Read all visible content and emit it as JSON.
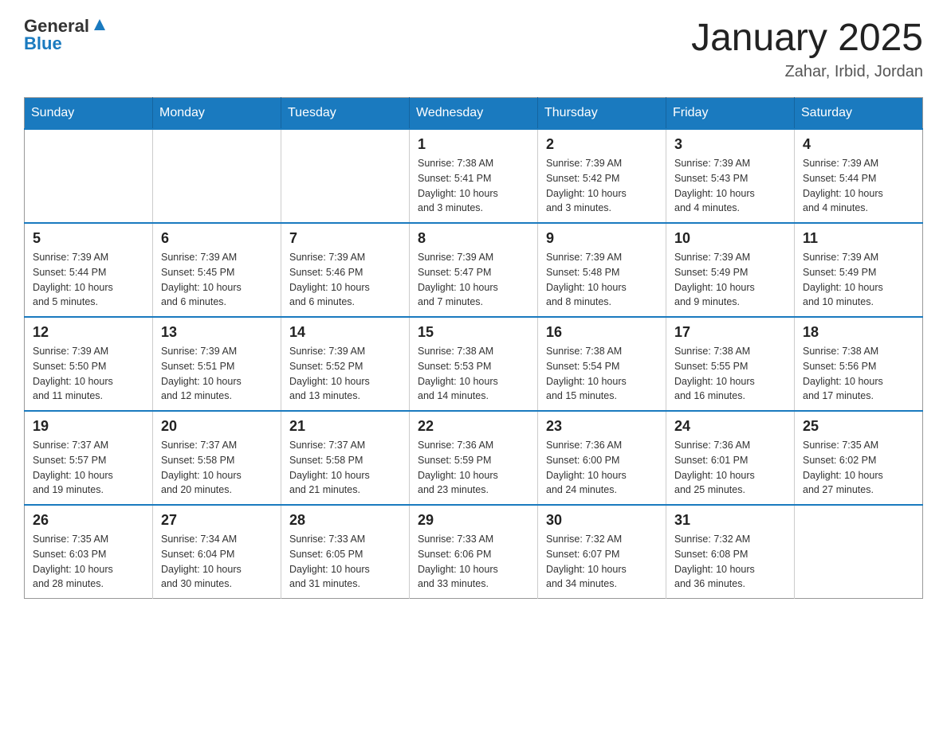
{
  "header": {
    "logo_text": "General",
    "logo_blue": "Blue",
    "title": "January 2025",
    "subtitle": "Zahar, Irbid, Jordan"
  },
  "days_of_week": [
    "Sunday",
    "Monday",
    "Tuesday",
    "Wednesday",
    "Thursday",
    "Friday",
    "Saturday"
  ],
  "weeks": [
    [
      {
        "day": "",
        "info": ""
      },
      {
        "day": "",
        "info": ""
      },
      {
        "day": "",
        "info": ""
      },
      {
        "day": "1",
        "info": "Sunrise: 7:38 AM\nSunset: 5:41 PM\nDaylight: 10 hours\nand 3 minutes."
      },
      {
        "day": "2",
        "info": "Sunrise: 7:39 AM\nSunset: 5:42 PM\nDaylight: 10 hours\nand 3 minutes."
      },
      {
        "day": "3",
        "info": "Sunrise: 7:39 AM\nSunset: 5:43 PM\nDaylight: 10 hours\nand 4 minutes."
      },
      {
        "day": "4",
        "info": "Sunrise: 7:39 AM\nSunset: 5:44 PM\nDaylight: 10 hours\nand 4 minutes."
      }
    ],
    [
      {
        "day": "5",
        "info": "Sunrise: 7:39 AM\nSunset: 5:44 PM\nDaylight: 10 hours\nand 5 minutes."
      },
      {
        "day": "6",
        "info": "Sunrise: 7:39 AM\nSunset: 5:45 PM\nDaylight: 10 hours\nand 6 minutes."
      },
      {
        "day": "7",
        "info": "Sunrise: 7:39 AM\nSunset: 5:46 PM\nDaylight: 10 hours\nand 6 minutes."
      },
      {
        "day": "8",
        "info": "Sunrise: 7:39 AM\nSunset: 5:47 PM\nDaylight: 10 hours\nand 7 minutes."
      },
      {
        "day": "9",
        "info": "Sunrise: 7:39 AM\nSunset: 5:48 PM\nDaylight: 10 hours\nand 8 minutes."
      },
      {
        "day": "10",
        "info": "Sunrise: 7:39 AM\nSunset: 5:49 PM\nDaylight: 10 hours\nand 9 minutes."
      },
      {
        "day": "11",
        "info": "Sunrise: 7:39 AM\nSunset: 5:49 PM\nDaylight: 10 hours\nand 10 minutes."
      }
    ],
    [
      {
        "day": "12",
        "info": "Sunrise: 7:39 AM\nSunset: 5:50 PM\nDaylight: 10 hours\nand 11 minutes."
      },
      {
        "day": "13",
        "info": "Sunrise: 7:39 AM\nSunset: 5:51 PM\nDaylight: 10 hours\nand 12 minutes."
      },
      {
        "day": "14",
        "info": "Sunrise: 7:39 AM\nSunset: 5:52 PM\nDaylight: 10 hours\nand 13 minutes."
      },
      {
        "day": "15",
        "info": "Sunrise: 7:38 AM\nSunset: 5:53 PM\nDaylight: 10 hours\nand 14 minutes."
      },
      {
        "day": "16",
        "info": "Sunrise: 7:38 AM\nSunset: 5:54 PM\nDaylight: 10 hours\nand 15 minutes."
      },
      {
        "day": "17",
        "info": "Sunrise: 7:38 AM\nSunset: 5:55 PM\nDaylight: 10 hours\nand 16 minutes."
      },
      {
        "day": "18",
        "info": "Sunrise: 7:38 AM\nSunset: 5:56 PM\nDaylight: 10 hours\nand 17 minutes."
      }
    ],
    [
      {
        "day": "19",
        "info": "Sunrise: 7:37 AM\nSunset: 5:57 PM\nDaylight: 10 hours\nand 19 minutes."
      },
      {
        "day": "20",
        "info": "Sunrise: 7:37 AM\nSunset: 5:58 PM\nDaylight: 10 hours\nand 20 minutes."
      },
      {
        "day": "21",
        "info": "Sunrise: 7:37 AM\nSunset: 5:58 PM\nDaylight: 10 hours\nand 21 minutes."
      },
      {
        "day": "22",
        "info": "Sunrise: 7:36 AM\nSunset: 5:59 PM\nDaylight: 10 hours\nand 23 minutes."
      },
      {
        "day": "23",
        "info": "Sunrise: 7:36 AM\nSunset: 6:00 PM\nDaylight: 10 hours\nand 24 minutes."
      },
      {
        "day": "24",
        "info": "Sunrise: 7:36 AM\nSunset: 6:01 PM\nDaylight: 10 hours\nand 25 minutes."
      },
      {
        "day": "25",
        "info": "Sunrise: 7:35 AM\nSunset: 6:02 PM\nDaylight: 10 hours\nand 27 minutes."
      }
    ],
    [
      {
        "day": "26",
        "info": "Sunrise: 7:35 AM\nSunset: 6:03 PM\nDaylight: 10 hours\nand 28 minutes."
      },
      {
        "day": "27",
        "info": "Sunrise: 7:34 AM\nSunset: 6:04 PM\nDaylight: 10 hours\nand 30 minutes."
      },
      {
        "day": "28",
        "info": "Sunrise: 7:33 AM\nSunset: 6:05 PM\nDaylight: 10 hours\nand 31 minutes."
      },
      {
        "day": "29",
        "info": "Sunrise: 7:33 AM\nSunset: 6:06 PM\nDaylight: 10 hours\nand 33 minutes."
      },
      {
        "day": "30",
        "info": "Sunrise: 7:32 AM\nSunset: 6:07 PM\nDaylight: 10 hours\nand 34 minutes."
      },
      {
        "day": "31",
        "info": "Sunrise: 7:32 AM\nSunset: 6:08 PM\nDaylight: 10 hours\nand 36 minutes."
      },
      {
        "day": "",
        "info": ""
      }
    ]
  ]
}
